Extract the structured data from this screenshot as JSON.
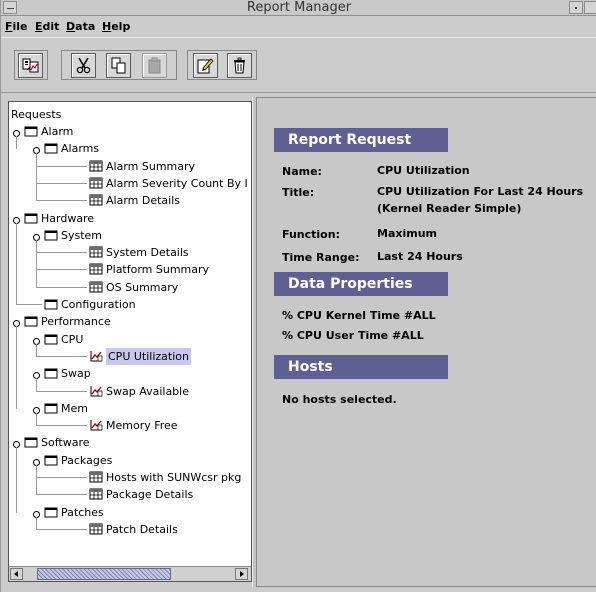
{
  "window": {
    "title": "Report Manager"
  },
  "menubar": [
    {
      "label": "File",
      "mnemonic": "F",
      "rest": "ile"
    },
    {
      "label": "Edit",
      "mnemonic": "E",
      "rest": "dit"
    },
    {
      "label": "Data",
      "mnemonic": "D",
      "rest": "ata"
    },
    {
      "label": "Help",
      "mnemonic": "H",
      "rest": "elp"
    }
  ],
  "toolbar": {
    "buttons": [
      "new-report-icon",
      "cut-icon",
      "copy-icon",
      "paste-icon",
      "edit-icon",
      "delete-icon"
    ]
  },
  "tree": {
    "root": "Requests",
    "nodes": [
      {
        "label": "Alarm",
        "type": "folder"
      },
      {
        "label": "Alarms",
        "type": "folder"
      },
      {
        "label": "Alarm Summary",
        "type": "report"
      },
      {
        "label": "Alarm Severity Count By I",
        "type": "report"
      },
      {
        "label": "Alarm Details",
        "type": "report"
      },
      {
        "label": "Hardware",
        "type": "folder"
      },
      {
        "label": "System",
        "type": "folder"
      },
      {
        "label": "System Details",
        "type": "report"
      },
      {
        "label": "Platform Summary",
        "type": "report"
      },
      {
        "label": "OS Summary",
        "type": "report"
      },
      {
        "label": "Configuration",
        "type": "folder"
      },
      {
        "label": "Performance",
        "type": "folder"
      },
      {
        "label": "CPU",
        "type": "folder"
      },
      {
        "label": "CPU Utilization",
        "type": "graph"
      },
      {
        "label": "Swap",
        "type": "folder"
      },
      {
        "label": "Swap Available",
        "type": "graph"
      },
      {
        "label": "Mem",
        "type": "folder"
      },
      {
        "label": "Memory Free",
        "type": "graph"
      },
      {
        "label": "Software",
        "type": "folder"
      },
      {
        "label": "Packages",
        "type": "folder"
      },
      {
        "label": "Hosts with SUNWcsr pkg",
        "type": "report"
      },
      {
        "label": "Package Details",
        "type": "report"
      },
      {
        "label": "Patches",
        "type": "folder"
      },
      {
        "label": "Patch Details",
        "type": "report"
      }
    ],
    "selected": "CPU Utilization"
  },
  "report": {
    "request_header": "Report Request",
    "name_label": "Name:",
    "name_value": "CPU Utilization",
    "title_label": "Title:",
    "title_value": "CPU Utilization For Last 24 Hours (Kernel Reader Simple)",
    "function_label": "Function:",
    "function_value": "Maximum",
    "timerange_label": "Time Range:",
    "timerange_value": "Last 24 Hours",
    "data_header": "Data Properties",
    "data_properties": [
      "% CPU Kernel Time #ALL",
      "% CPU User Time #ALL"
    ],
    "hosts_header": "Hosts",
    "hosts_text": "No hosts selected."
  },
  "colors": {
    "section_header_bg": "#5f5f93",
    "selection_bg": "#c8c8ef",
    "window_bg": "#cccccc"
  }
}
